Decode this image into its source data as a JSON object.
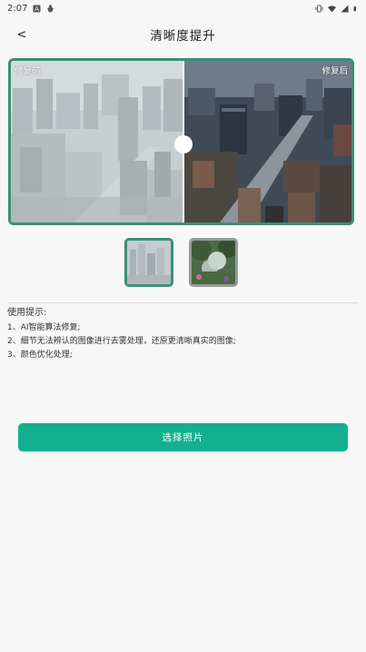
{
  "statusbar": {
    "time": "2:07",
    "left_icons": [
      "a-badge-icon",
      "bug-icon"
    ],
    "right_icons": [
      "vibrate-icon",
      "wifi-icon",
      "signal-icon",
      "battery-icon"
    ]
  },
  "header": {
    "back_label": "<",
    "title": "清晰度提升"
  },
  "compare": {
    "before_label": "修复前",
    "after_label": "修复后",
    "split": 0.5
  },
  "thumbnails": [
    {
      "name": "city-haze",
      "selected": true
    },
    {
      "name": "forest-mist",
      "selected": false
    }
  ],
  "tips": {
    "title": "使用提示:",
    "items": [
      "1、AI智能算法修复;",
      "2、细节无法辨认的图像进行去雾处理，还原更清晰真实的图像;",
      "3、颜色优化处理;"
    ]
  },
  "action": {
    "label": "选择照片"
  },
  "colors": {
    "accent": "#12b08f",
    "frame": "#3d8f75",
    "background": "#f7f7f7"
  }
}
